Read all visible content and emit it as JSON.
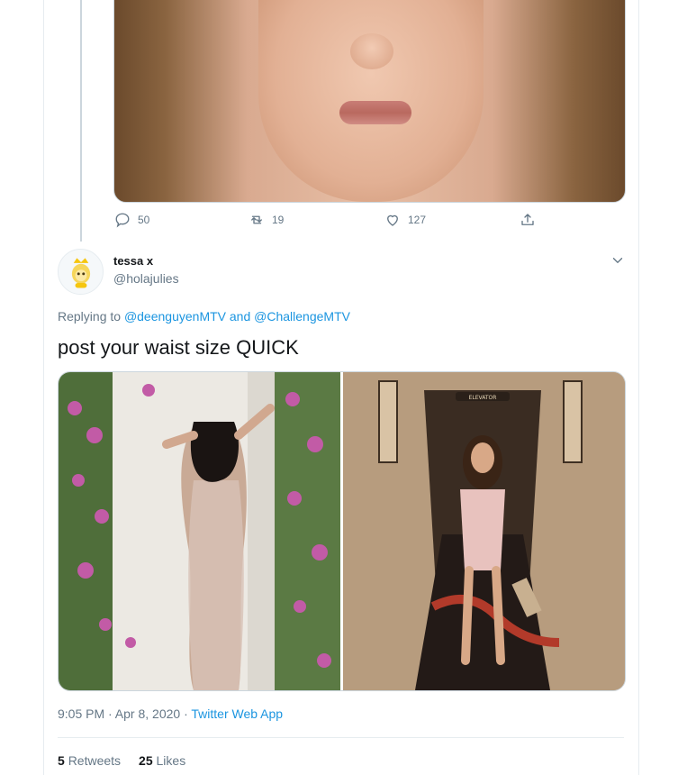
{
  "previous_tweet": {
    "actions": {
      "reply_count": "50",
      "retweet_count": "19",
      "like_count": "127"
    }
  },
  "tweet": {
    "display_name": "tessa x",
    "handle": "@holajulies",
    "replying_prefix": "Replying to",
    "replying_user_1": "@deenguyenMTV",
    "replying_and": "and",
    "replying_user_2": "@ChallengeMTV",
    "text": "post your waist size QUICK",
    "time": "9:05 PM · Apr 8, 2020",
    "separator": "·",
    "source": "Twitter Web App",
    "retweets_count": "5",
    "retweets_label": "Retweets",
    "likes_count": "25",
    "likes_label": "Likes",
    "media_right_sign": "ELEVATOR"
  },
  "colors": {
    "link": "#1b95e0",
    "muted": "#657786",
    "text": "#14171a",
    "border": "#e6ecf0"
  },
  "icons": [
    "reply-icon",
    "retweet-icon",
    "like-icon",
    "share-icon",
    "chevron-down-icon",
    "avatar-emoji"
  ]
}
